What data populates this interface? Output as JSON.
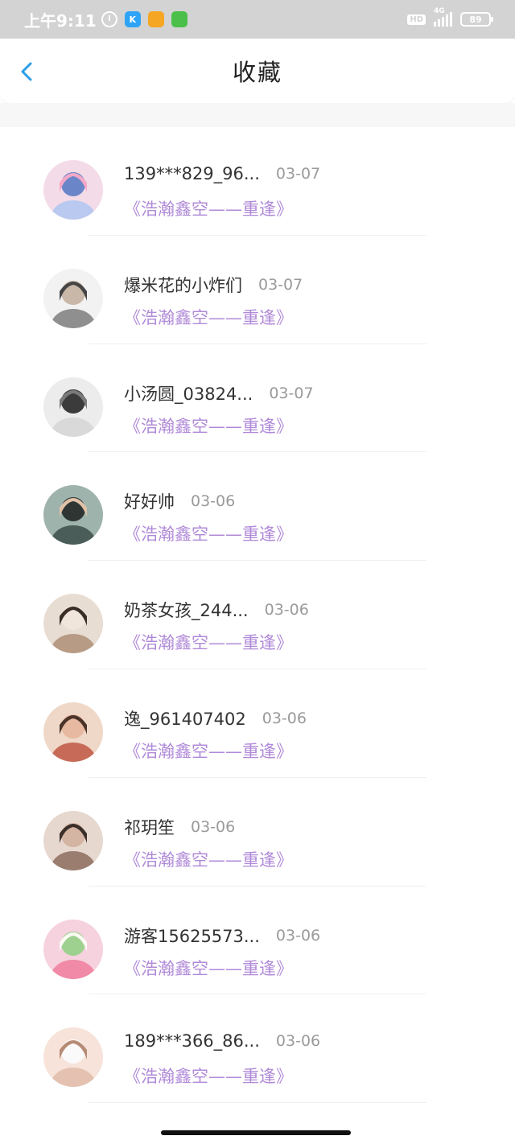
{
  "status_bar": {
    "time": "上午9:11",
    "apps": [
      {
        "icon": "k-app-icon",
        "text": "K",
        "color": "#2fa3f6"
      },
      {
        "icon": "folder-app-icon",
        "text": "",
        "color": "#f5a623"
      },
      {
        "icon": "green-app-icon",
        "text": "",
        "color": "#4cbf4a"
      }
    ],
    "hd": "HD",
    "network": "4G",
    "battery": "89"
  },
  "header": {
    "title": "收藏",
    "accent": "#2a9de8"
  },
  "favorites": [
    {
      "name": "139***829_96...",
      "date": "03-07",
      "work": "《浩瀚鑫空——重逢》"
    },
    {
      "name": "爆米花的小炸们",
      "date": "03-07",
      "work": "《浩瀚鑫空——重逢》"
    },
    {
      "name": "小汤圆_03824...",
      "date": "03-07",
      "work": "《浩瀚鑫空——重逢》"
    },
    {
      "name": "好好帅",
      "date": "03-06",
      "work": "《浩瀚鑫空——重逢》"
    },
    {
      "name": "奶茶女孩_244...",
      "date": "03-06",
      "work": "《浩瀚鑫空——重逢》"
    },
    {
      "name": "逸_961407402",
      "date": "03-06",
      "work": "《浩瀚鑫空——重逢》"
    },
    {
      "name": "祁玥笙",
      "date": "03-06",
      "work": "《浩瀚鑫空——重逢》"
    },
    {
      "name": "游客15625573...",
      "date": "03-06",
      "work": "《浩瀚鑫空——重逢》"
    },
    {
      "name": "189***366_86...",
      "date": "03-06",
      "work": "《浩瀚鑫空——重逢》"
    }
  ]
}
